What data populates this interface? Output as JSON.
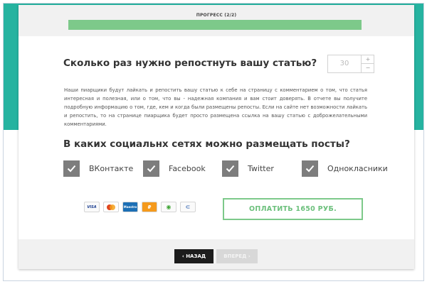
{
  "progress": {
    "label": "ПРОГРЕСС (2/2)",
    "fraction": 1.0
  },
  "question1": {
    "title": "Сколько раз нужно репостнуть вашу статью?",
    "stepper": {
      "value": "30",
      "plus": "+",
      "minus": "−"
    },
    "description": "Наши пиарщики будут лайкать и репостить вашу статью к себе на страницу с комментарием о том, что статья интересная и полезная, или о том, что вы - надежная компания и вам стоит доверять. В отчете вы получите подробную информацию о том, где, кем и когда были размещены репосты. Если на сайте нет возможности лайкать и репостить, то на странице пиарщика будет просто размещена ссылка на вашу статью с доброжелательными комментариями."
  },
  "question2": {
    "title": "В каких социальнх сетях можно размещать посты?",
    "networks": [
      {
        "label": "ВКонтакте",
        "checked": true
      },
      {
        "label": "Facebook",
        "checked": true
      },
      {
        "label": "Twitter",
        "checked": true
      },
      {
        "label": "Однокласники",
        "checked": true
      }
    ]
  },
  "payment": {
    "icons": [
      {
        "name": "visa-icon",
        "text": "VISA",
        "color": "#1a3d8f"
      },
      {
        "name": "mastercard-icon",
        "text": "MC",
        "color": "#e0451f"
      },
      {
        "name": "maestro-icon",
        "text": "Maestro",
        "color": "#1c6fb5"
      },
      {
        "name": "yandex-money-icon",
        "text": "₽",
        "color": "#f59a1c"
      },
      {
        "name": "sberbank-icon",
        "text": "◉",
        "color": "#3fa535"
      },
      {
        "name": "wallet-icon",
        "text": "⊂",
        "color": "#3e6db5"
      }
    ],
    "button_label": "ОПЛАТИТЬ 1650 РУБ."
  },
  "nav": {
    "back_label": "‹ НАЗАД",
    "next_label": "ВПЕРЕД ›"
  },
  "colors": {
    "teal": "#26b3a0",
    "accent_green": "#7dc98a",
    "checkbox_gray": "#7d7d7d"
  }
}
